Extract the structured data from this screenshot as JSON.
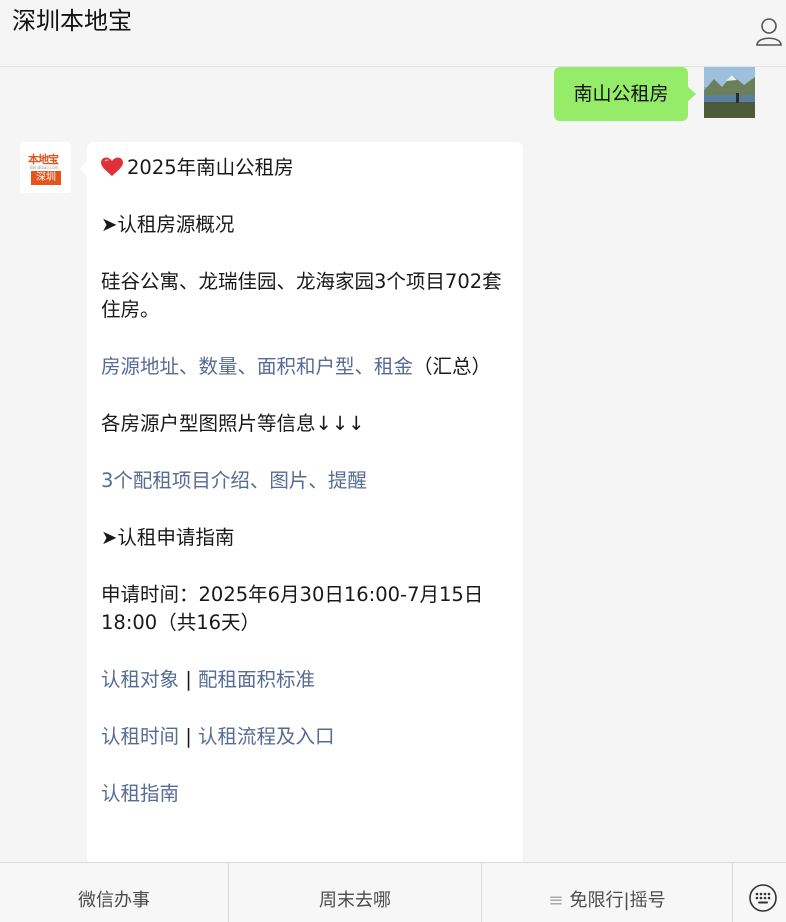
{
  "header": {
    "title": "深圳本地宝",
    "profile_icon": "person-icon"
  },
  "sent_message": {
    "text": "南山公租房"
  },
  "received_message": {
    "avatar": {
      "brand_text": "本地宝",
      "url_text": "Bendibao.com",
      "city_text": "深圳"
    },
    "title": "2025年南山公租房",
    "section1": "➤认租房源概况",
    "overview": "硅谷公寓、龙瑞佳园、龙海家园3个项目702套住房。",
    "link_summary": "房源地址、数量、面积和户型、租金",
    "summary_suffix": "（汇总）",
    "photos_info": "各房源户型图照片等信息↓↓↓",
    "link_projects": "3个配租项目介绍、图片、提醒",
    "section2": "➤认租申请指南",
    "apply_time": "申请时间：2025年6月30日16:00-7月15日18:00（共16天）",
    "link_object": "认租对象",
    "link_area_standard": "配租面积标准",
    "link_time": "认租时间",
    "link_process": "认租流程及入口",
    "separator": " | ",
    "link_guide": "认租指南"
  },
  "bottom_menu": {
    "items": [
      "微信办事",
      "周末去哪",
      "免限行|摇号"
    ],
    "menu_indicator": "≡",
    "keyboard_icon": "keyboard-icon"
  },
  "colors": {
    "sent_bubble": "#95ec69",
    "link": "#576b95",
    "brand_orange": "#e2541c",
    "heart": "#e0303a"
  }
}
